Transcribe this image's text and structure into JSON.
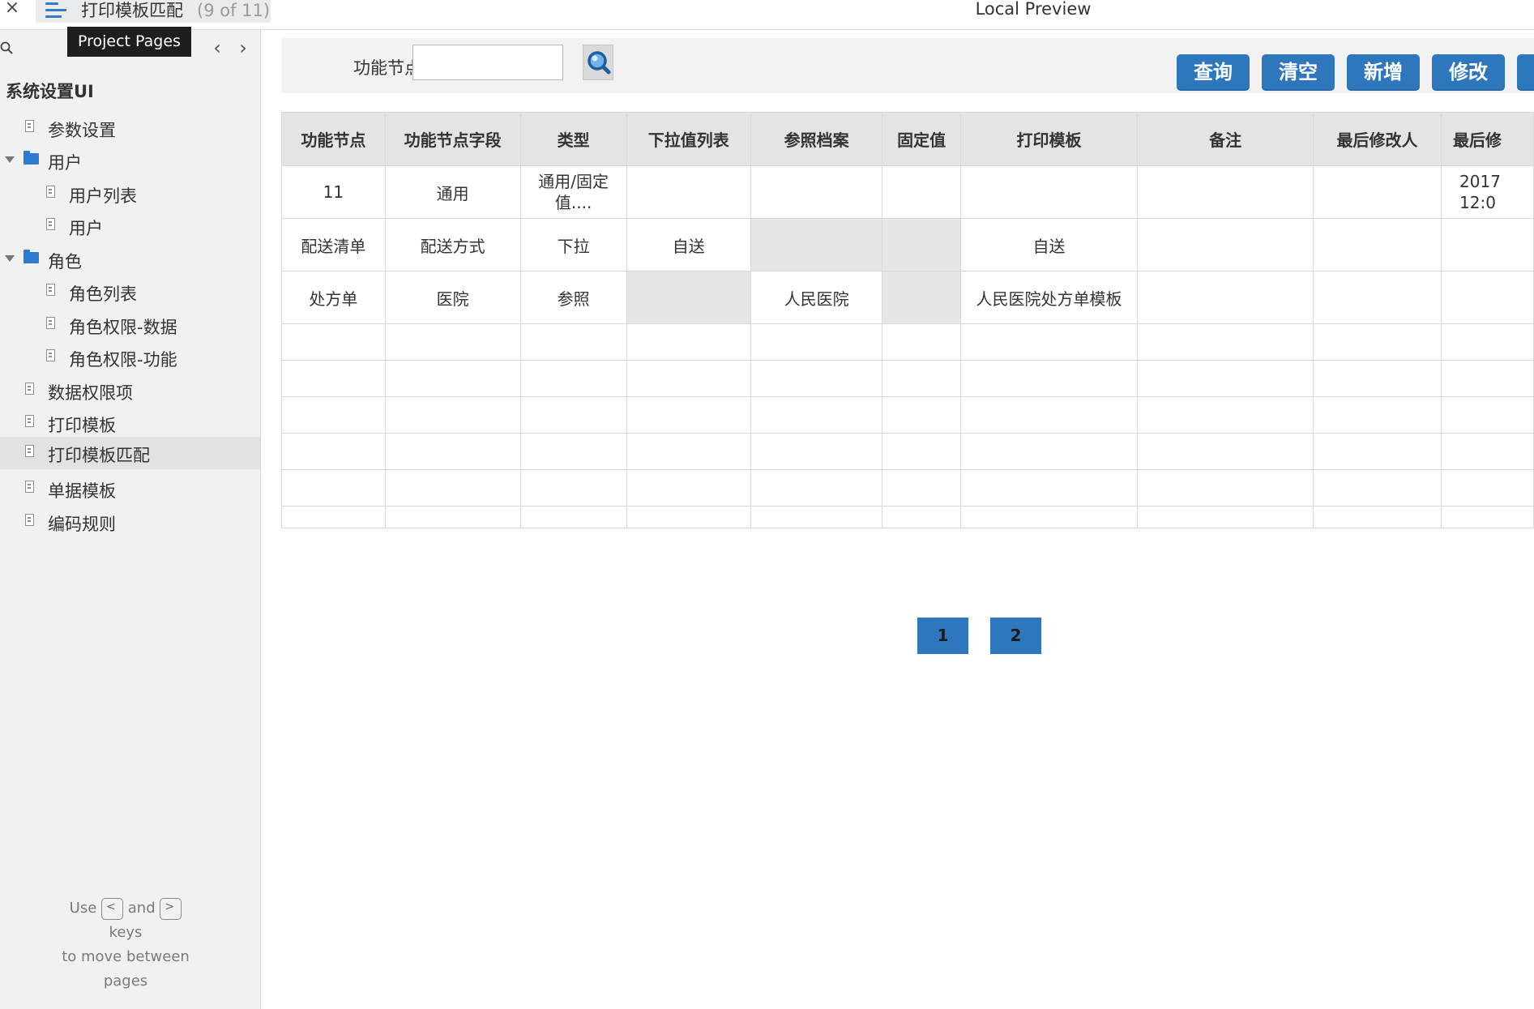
{
  "topbar": {
    "close_glyph": "×",
    "page_title": "打印模板匹配",
    "page_count": "(9 of 11)",
    "window_title": "Local Preview",
    "tooltip": "Project Pages"
  },
  "sidebar": {
    "project_name": "系统设置UI",
    "prev_glyph": "‹",
    "next_glyph": "›",
    "items": [
      {
        "label": "参数设置",
        "type": "page"
      },
      {
        "label": "用户",
        "type": "folder"
      },
      {
        "label": "用户列表",
        "type": "page"
      },
      {
        "label": "用户",
        "type": "page"
      },
      {
        "label": "角色",
        "type": "folder"
      },
      {
        "label": "角色列表",
        "type": "page"
      },
      {
        "label": "角色权限-数据",
        "type": "page"
      },
      {
        "label": "角色权限-功能",
        "type": "page"
      },
      {
        "label": "数据权限项",
        "type": "page"
      },
      {
        "label": "打印模板",
        "type": "page"
      },
      {
        "label": "打印模板匹配",
        "type": "page",
        "active": true
      },
      {
        "label": "单据模板",
        "type": "page"
      },
      {
        "label": "编码规则",
        "type": "page"
      }
    ],
    "hint": {
      "use": "Use",
      "key_prev": "<",
      "and": "and",
      "key_next": ">",
      "keys": "keys",
      "line2": "to move between",
      "line3": "pages"
    }
  },
  "filter": {
    "label": "功能节点",
    "value": "",
    "buttons": [
      "查询",
      "清空",
      "新增",
      "修改",
      ""
    ]
  },
  "table": {
    "columns": [
      "功能节点",
      "功能节点字段",
      "类型",
      "下拉值列表",
      "参照档案",
      "固定值",
      "打印模板",
      "备注",
      "最后修改人",
      "最后修"
    ],
    "rows": [
      [
        "11",
        "通用",
        "通用/固定值....",
        "",
        "",
        "",
        "",
        "",
        "",
        "2017 12:0"
      ],
      [
        "配送清单",
        "配送方式",
        "下拉",
        "自送",
        "",
        "",
        "自送",
        "",
        "",
        ""
      ],
      [
        "处方单",
        "医院",
        "参照",
        "",
        "人民医院",
        "",
        "人民医院处方单模板",
        "",
        "",
        ""
      ]
    ]
  },
  "pagination": [
    "1",
    "2"
  ],
  "colors": {
    "accent": "#2f77bd",
    "icon_blue": "#2f7bd1",
    "header_bg": "#e4e4e4",
    "sidebar_bg": "#f1f1f1"
  }
}
